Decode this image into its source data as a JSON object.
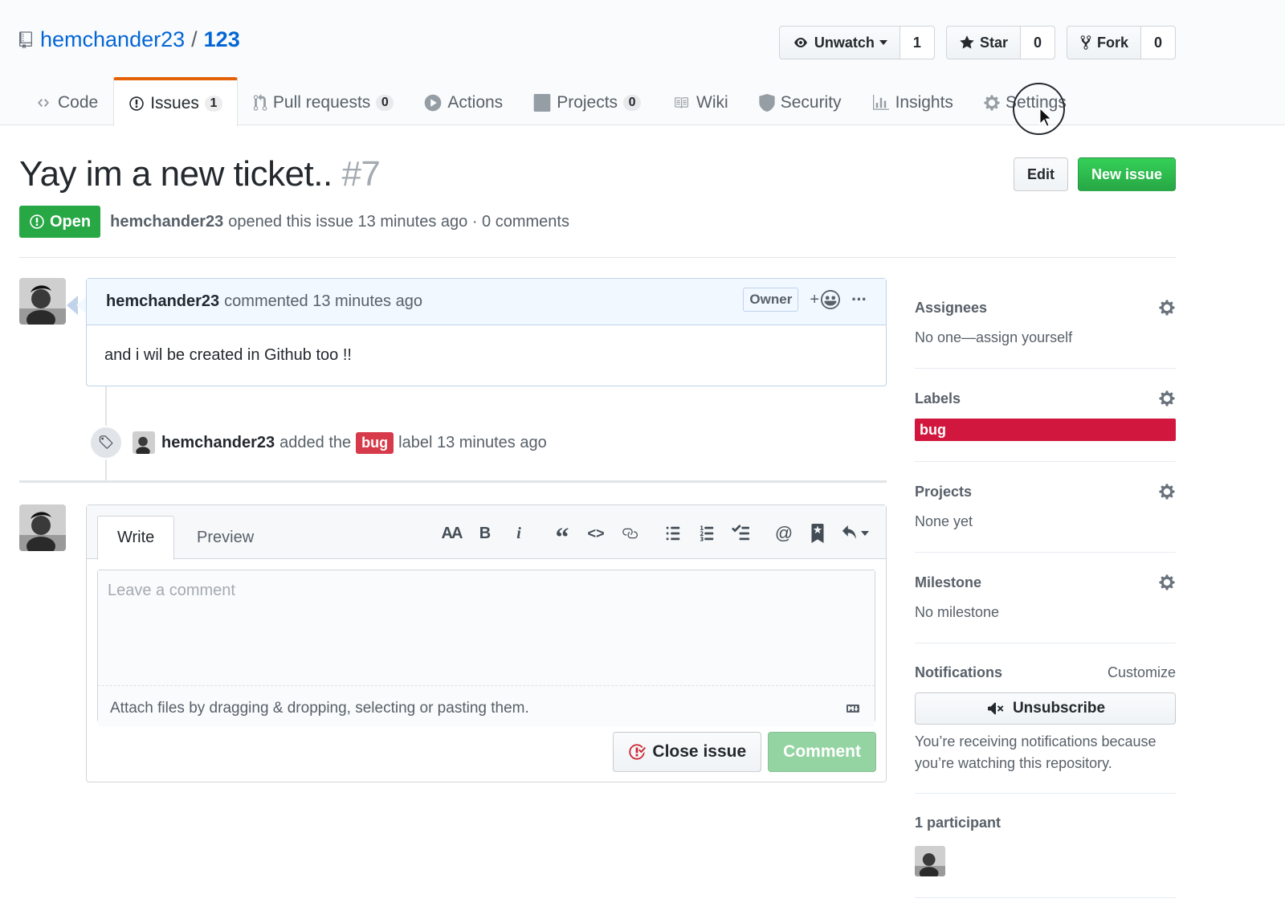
{
  "repo": {
    "owner": "hemchander23",
    "separator": "/",
    "name": "123",
    "actions": {
      "watch": {
        "label": "Unwatch",
        "count": "1"
      },
      "star": {
        "label": "Star",
        "count": "0"
      },
      "fork": {
        "label": "Fork",
        "count": "0"
      }
    }
  },
  "nav": {
    "code": "Code",
    "issues": "Issues",
    "issues_count": "1",
    "pulls": "Pull requests",
    "pulls_count": "0",
    "actions": "Actions",
    "projects": "Projects",
    "projects_count": "0",
    "wiki": "Wiki",
    "security": "Security",
    "insights": "Insights",
    "settings": "Settings"
  },
  "issue": {
    "title": "Yay im a new ticket..",
    "number": "#7",
    "edit_label": "Edit",
    "new_issue_label": "New issue",
    "state": "Open",
    "author": "hemchander23",
    "meta_text": "opened this issue 13 minutes ago · 0 comments"
  },
  "comment": {
    "author": "hemchander23",
    "action": "commented 13 minutes ago",
    "owner_label": "Owner",
    "reaction_plus": "+",
    "more": "···",
    "body": "and i wil be created in Github too !!"
  },
  "event": {
    "author": "hemchander23",
    "text_before": "added the",
    "label": "bug",
    "text_after": "label 13 minutes ago"
  },
  "new_comment": {
    "tab_write": "Write",
    "tab_preview": "Preview",
    "toolbar": {
      "header": "AA",
      "bold": "B",
      "italic": "i",
      "quote": "“",
      "code": "<>",
      "mention": "@"
    },
    "placeholder": "Leave a comment",
    "drag_hint": "Attach files by dragging & dropping, selecting or pasting them.",
    "close_label": "Close issue",
    "comment_label": "Comment"
  },
  "sidebar": {
    "assignees": {
      "heading": "Assignees",
      "text": "No one—assign yourself"
    },
    "labels": {
      "heading": "Labels",
      "label": "bug",
      "label_color": "#d1173d"
    },
    "projects": {
      "heading": "Projects",
      "text": "None yet"
    },
    "milestone": {
      "heading": "Milestone",
      "text": "No milestone"
    },
    "notifications": {
      "heading": "Notifications",
      "customize": "Customize",
      "button": "Unsubscribe",
      "reason": "You’re receiving notifications because you’re watching this repository."
    },
    "participants": {
      "heading": "1 participant"
    }
  },
  "colors": {
    "accent_link": "#0366d6",
    "open_green": "#28a745",
    "bug_red": "#d73a4a",
    "tab_underline": "#e36209"
  }
}
